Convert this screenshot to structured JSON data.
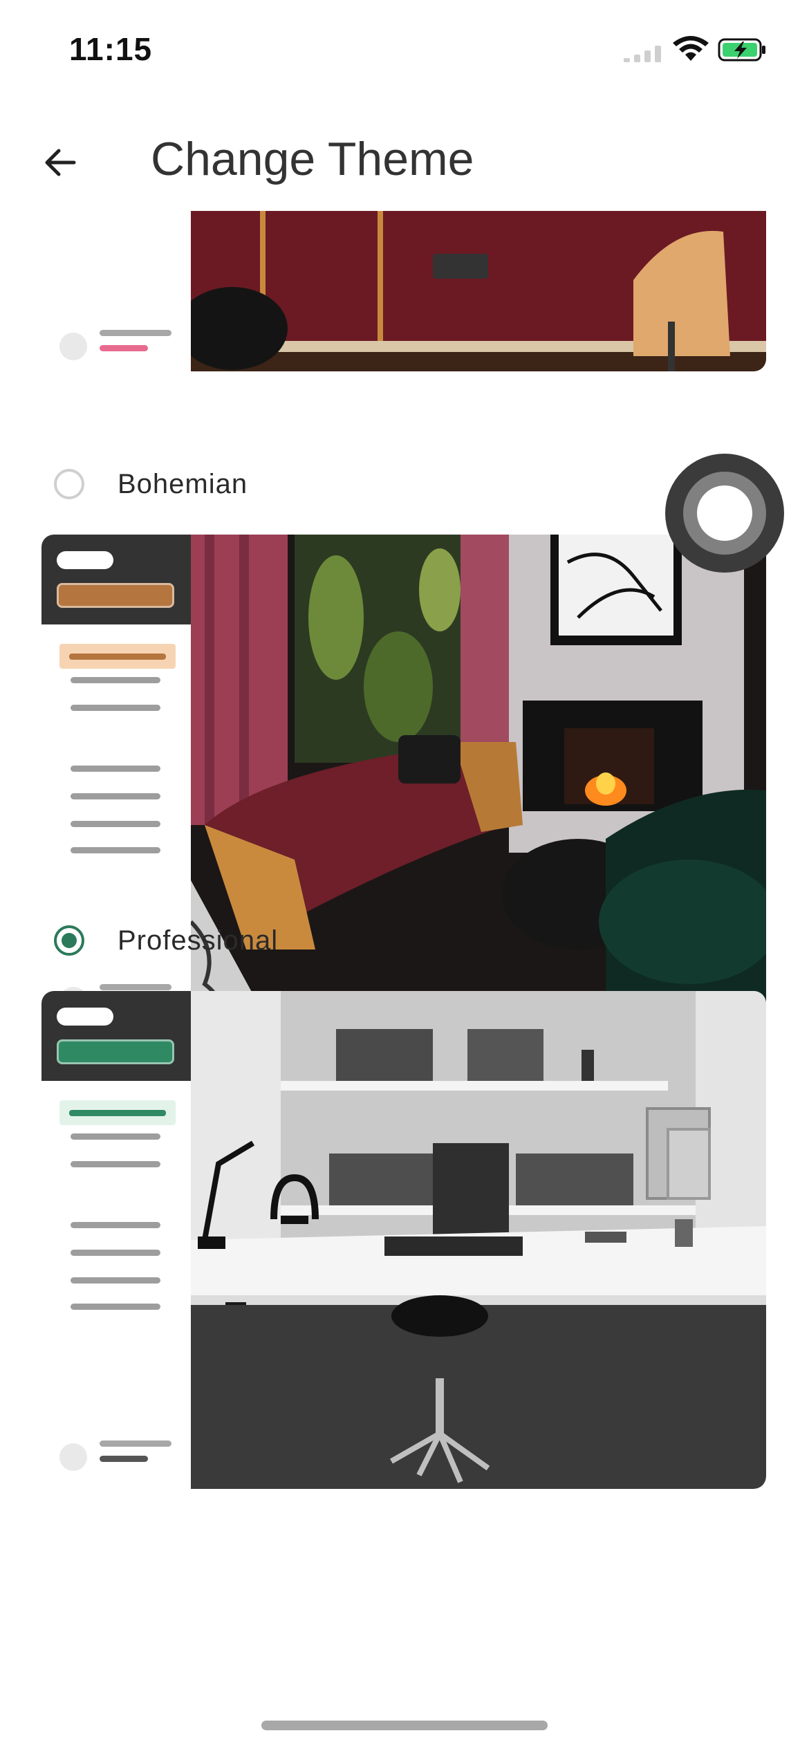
{
  "status_bar": {
    "time": "11:15",
    "icons": [
      "signal-icon",
      "wifi-icon",
      "battery-charging-icon"
    ],
    "battery_color": "#3bd16f"
  },
  "app_bar": {
    "back_icon": "arrow-left-icon",
    "title": "Change Theme"
  },
  "themes": [
    {
      "id": "partial-top",
      "name": "",
      "selected": false,
      "accent": "#e86b8f",
      "visible_part": "bottom"
    },
    {
      "id": "bohemian",
      "name": "Bohemian",
      "selected": false,
      "accent": "#b5753e",
      "accent_light": "#f6d4b3",
      "bottom_accent": "#d4691e"
    },
    {
      "id": "professional",
      "name": "Professional",
      "selected": true,
      "accent": "#2f8a64",
      "accent_light": "#e3f3ea",
      "bottom_accent": "#555555"
    }
  ],
  "colors": {
    "radio_selected": "#2b7a5b",
    "radio_unselected": "#cfcfcf",
    "sidebar_header": "#333333"
  }
}
